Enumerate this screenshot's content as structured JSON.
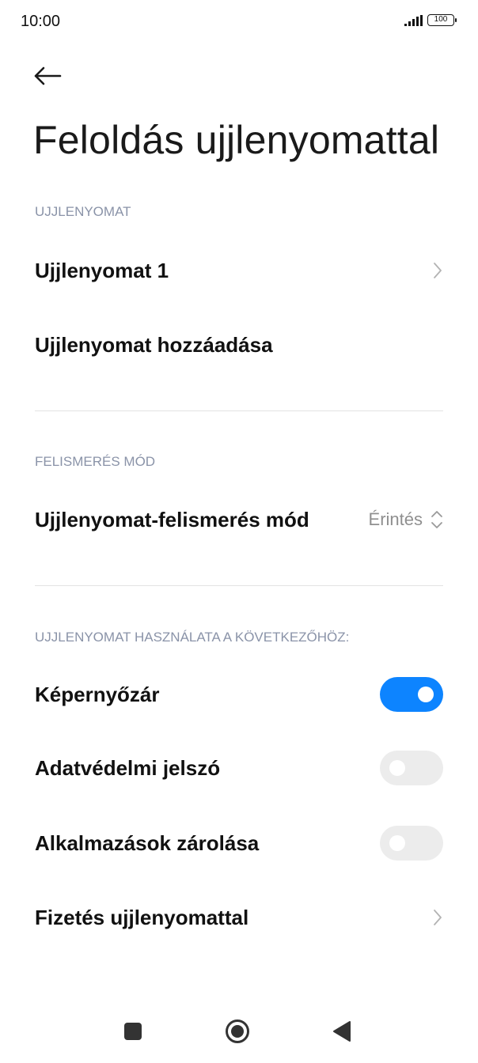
{
  "status_bar": {
    "time": "10:00",
    "battery": "100"
  },
  "header": {
    "title": "Feloldás ujjlenyomattal"
  },
  "sections": {
    "fingerprint": {
      "header": "UJJLENYOMAT",
      "items": [
        {
          "label": "Ujjlenyomat 1"
        },
        {
          "label": "Ujjlenyomat hozzáadása"
        }
      ]
    },
    "recognition": {
      "header": "FELISMERÉS MÓD",
      "item": {
        "label": "Ujjlenyomat-felismerés mód",
        "value": "Érintés"
      }
    },
    "usage": {
      "header": "UJJLENYOMAT HASZNÁLATA A KÖVETKEZŐHÖZ:",
      "items": [
        {
          "label": "Képernyőzár",
          "enabled": true
        },
        {
          "label": "Adatvédelmi jelszó",
          "enabled": false
        },
        {
          "label": "Alkalmazások zárolása",
          "enabled": false
        },
        {
          "label": "Fizetés ujjlenyomattal"
        }
      ]
    }
  },
  "colors": {
    "accent": "#0d84ff",
    "section_header": "#8a93a8",
    "toggle_off": "#ececec"
  },
  "nav_bar": {
    "icons": [
      "recents-square-icon",
      "home-circle-icon",
      "back-triangle-icon"
    ]
  }
}
